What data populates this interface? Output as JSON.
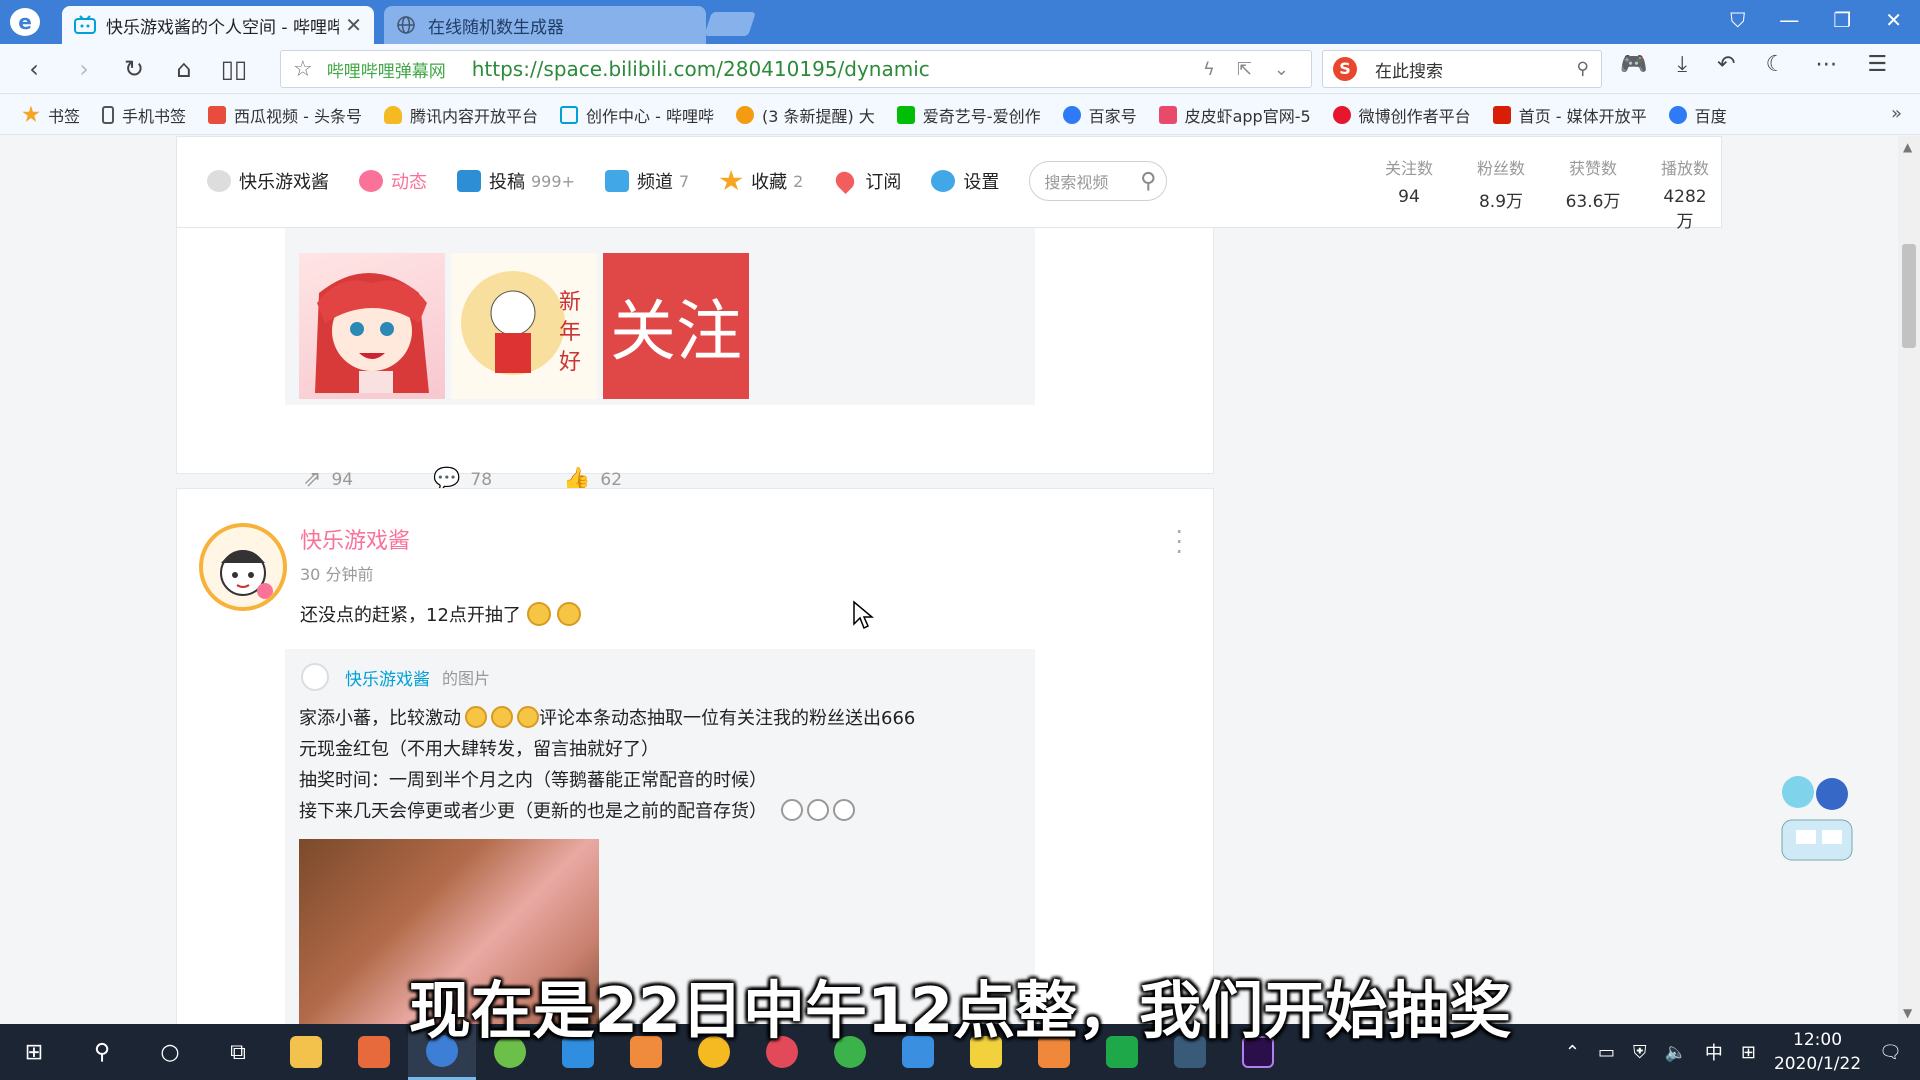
{
  "browser": {
    "tabs": [
      {
        "label": "快乐游戏酱的个人空间 - 哔哩哔",
        "active": true
      },
      {
        "label": "在线随机数生成器",
        "active": false
      }
    ],
    "site_name": "哔哩哔哩弹幕网",
    "url": "https://space.bilibili.com/280410195/dynamic",
    "search_placeholder": "在此搜索"
  },
  "bookmarks": [
    {
      "label": "书签",
      "color": "#f5a623"
    },
    {
      "label": "手机书签",
      "color": "#ffffff"
    },
    {
      "label": "西瓜视频 - 头条号",
      "color": "#e74c3c"
    },
    {
      "label": "腾讯内容开放平台",
      "color": "#f5b921"
    },
    {
      "label": "创作中心 - 哔哩哔",
      "color": "#00a1d6"
    },
    {
      "label": "(3 条新提醒) 大",
      "color": "#f39c12"
    },
    {
      "label": "爱奇艺号-爱创作",
      "color": "#00be06"
    },
    {
      "label": "百家号",
      "color": "#2e7bf5"
    },
    {
      "label": "皮皮虾app官网-5",
      "color": "#e84a6a"
    },
    {
      "label": "微博创作者平台",
      "color": "#e6162d"
    },
    {
      "label": "首页 - 媒体开放平",
      "color": "#d81e06"
    },
    {
      "label": "百度",
      "color": "#2e7bf5"
    }
  ],
  "space_nav": {
    "username": "快乐游戏酱",
    "items": [
      {
        "label": "动态",
        "count": "",
        "active": true,
        "color": "#fb7299"
      },
      {
        "label": "投稿",
        "count": "999+",
        "active": false,
        "color": "#2d8ed6"
      },
      {
        "label": "频道",
        "count": "7",
        "active": false,
        "color": "#41a7e6"
      },
      {
        "label": "收藏",
        "count": "2",
        "active": false,
        "color": "#f5a623"
      },
      {
        "label": "订阅",
        "count": "",
        "active": false,
        "color": "#f25d5d"
      },
      {
        "label": "设置",
        "count": "",
        "active": false,
        "color": "#41a7e6"
      }
    ],
    "search_placeholder": "搜索视频"
  },
  "stats": [
    {
      "label": "关注数",
      "value": "94"
    },
    {
      "label": "粉丝数",
      "value": "8.9万"
    },
    {
      "label": "获赞数",
      "value": "63.6万"
    },
    {
      "label": "播放数",
      "value": "4282万"
    }
  ],
  "post1": {
    "thumb3_text": "关注",
    "actions": {
      "share": "94",
      "comment": "78",
      "like": "62"
    }
  },
  "post2": {
    "author": "快乐游戏酱",
    "time": "30 分钟前",
    "text": "还没点的赶紧，12点开抽了",
    "repost": {
      "author": "快乐游戏酱",
      "suffix": "的图片",
      "lines": [
        "家添小蕃，比较激动",
        "评论本条动态抽取一位有关注我的粉丝送出666",
        "元现金红包（不用大肆转发，留言抽就好了）",
        "抽奖时间：一周到半个月之内（等鹅蕃能正常配音的时候）",
        "接下来几天会停更或者少更（更新的也是之前的配音存货）"
      ]
    }
  },
  "subtitle": "现在是22日中午12点整，我们开始抽奖",
  "taskbar": {
    "tray_ime": "中",
    "time": "12:00",
    "date": "2020/1/22"
  }
}
